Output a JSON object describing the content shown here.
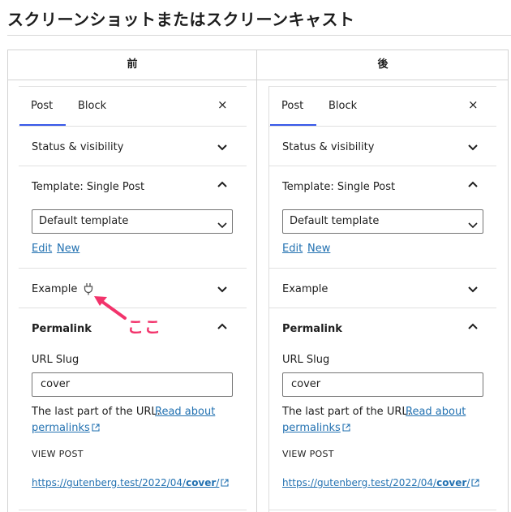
{
  "heading": "スクリーンショットまたはスクリーンキャスト",
  "columns": {
    "before": "前",
    "after": "後"
  },
  "panel": {
    "tabs": {
      "post": "Post",
      "block": "Block"
    },
    "close_symbol": "×",
    "status_visibility": "Status & visibility",
    "template_title": "Template: Single Post",
    "template_select_value": "Default template",
    "edit_link": "Edit",
    "new_link": "New",
    "example_title": "Example",
    "permalink_title": "Permalink",
    "url_slug_label": "URL Slug",
    "url_slug_value": "cover",
    "help_text": "The last part of the URL.",
    "read_about": "Read about",
    "permalinks": "permalinks",
    "view_post": "VIEW POST",
    "url_prefix": "https://gutenberg.test/2022/04/",
    "url_slug_bold": "cover",
    "url_suffix": "/"
  },
  "annotation": {
    "label": "ここ"
  },
  "colors": {
    "accent": "#3858e9",
    "link": "#2271b1",
    "annotation": "#f2336b"
  },
  "icons": [
    "close-icon",
    "chevron-down-icon",
    "chevron-up-icon",
    "plug-icon",
    "external-link-icon",
    "arrow-icon"
  ]
}
